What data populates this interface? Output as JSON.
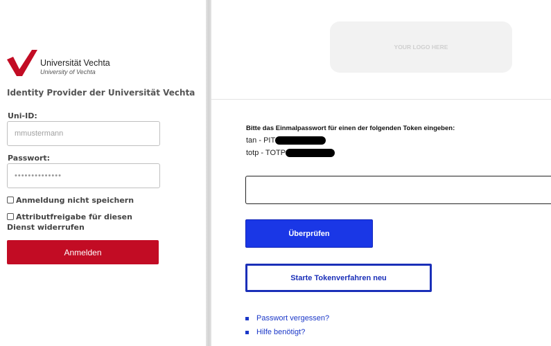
{
  "left_panel": {
    "logo": {
      "name": "Universität Vechta",
      "subtitle": "University of Vechta",
      "brand_color": "#c20c24"
    },
    "title": "Identity Provider der Universität Vechta",
    "uni_id": {
      "label": "Uni-ID:",
      "placeholder": "mmustermann"
    },
    "password": {
      "label": "Passwort:",
      "value": "••••••••••••••"
    },
    "checkboxes": [
      {
        "label": "Anmeldung nicht speichern",
        "checked": false
      },
      {
        "label_line1": "Attributfreigabe für diesen",
        "label_line2": "Dienst widerrufen",
        "checked": false
      }
    ],
    "login_button": "Anmelden"
  },
  "right_panel": {
    "logo_placeholder": "YOUR LOGO HERE",
    "prompt": "Bitte das Einmalpasswort für einen der folgenden Token eingeben:",
    "tokens": [
      {
        "text": "tan - PIT",
        "redacted": true
      },
      {
        "text": "totp - TOTP",
        "redacted": true
      }
    ],
    "otp_input_value": "",
    "verify_button": "Überprüfen",
    "restart_button": "Starte Tokenverfahren neu",
    "links": [
      {
        "label": "Passwort vergessen?",
        "icon": "square-bullet"
      },
      {
        "label": "Hilfe benötigt?",
        "icon": "square-bullet"
      }
    ],
    "accent_color": "#1a37e6"
  }
}
